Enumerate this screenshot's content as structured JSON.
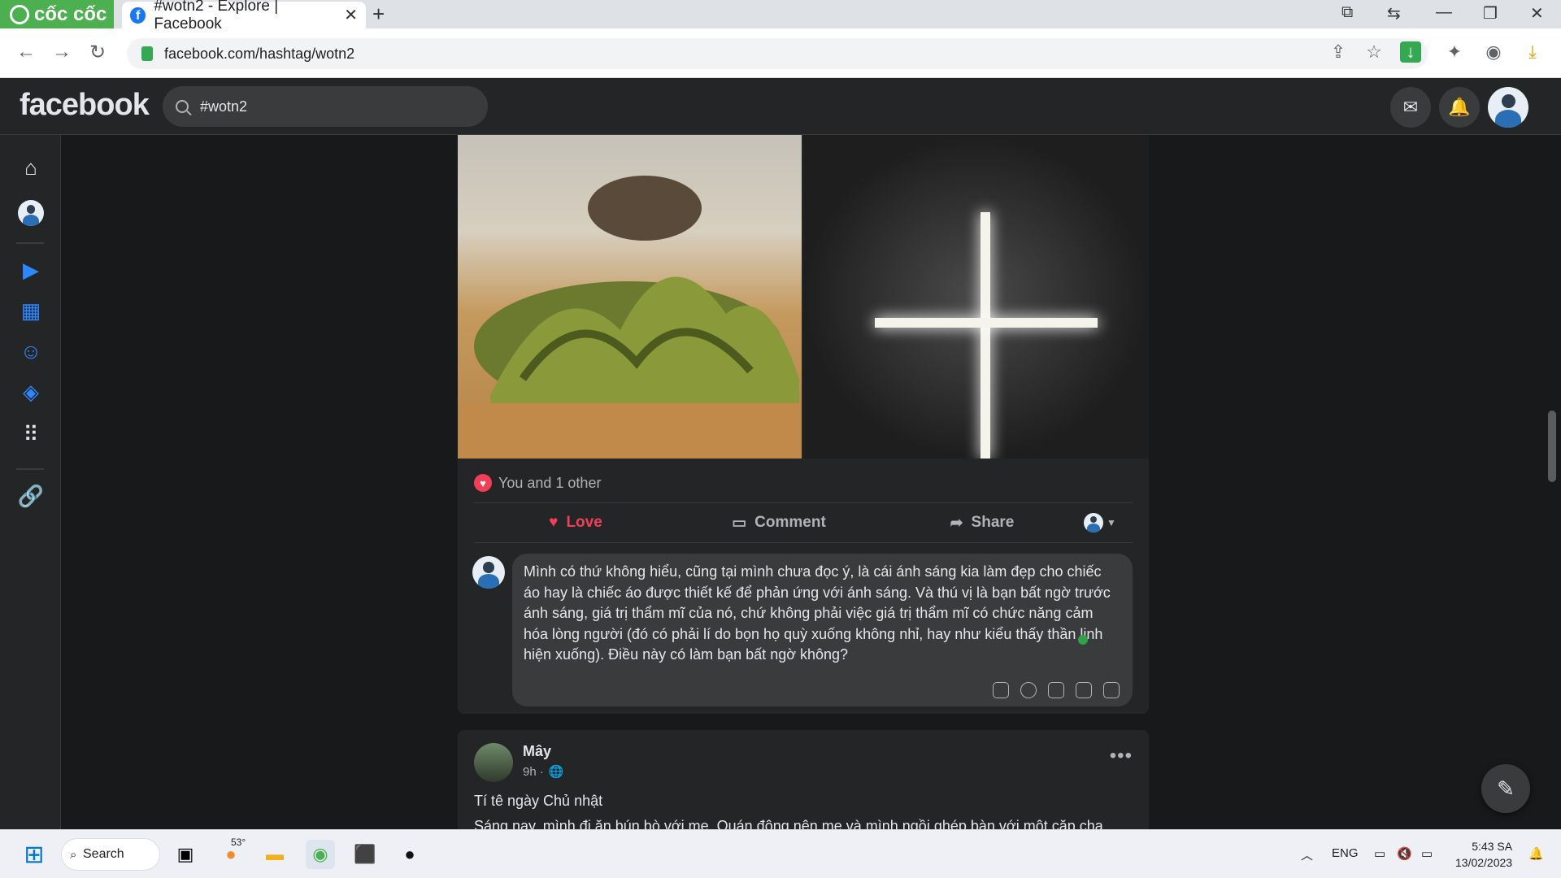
{
  "browser": {
    "brand": "cốc cốc",
    "tab_title": "#wotn2 - Explore | Facebook",
    "url": "facebook.com/hashtag/wotn2"
  },
  "fb": {
    "logo": "facebook",
    "search_value": "#wotn2"
  },
  "post1": {
    "reaction_summary": "You and 1 other",
    "actions": {
      "love": "Love",
      "comment": "Comment",
      "share": "Share"
    },
    "comment_text": "Mình có thứ không hiểu, cũng tại mình chưa đọc ý, là cái ánh sáng kia làm đẹp cho chiếc áo hay là chiếc áo được thiết kế để phản ứng với ánh sáng. Và thú vị là bạn bất ngờ trước ánh sáng, giá trị thẩm mĩ của nó, chứ không phải việc giá trị thẩm mĩ có chức năng cảm hóa lòng người (đó có phải lí do bọn họ quỳ xuống không nhỉ, hay như kiểu thấy thần linh hiện xuống). Điều này có làm bạn bất ngờ không?"
  },
  "post2": {
    "author": "Mây",
    "time": "9h ·",
    "title": "Tí tê ngày Chủ nhật",
    "body_preview": "Sáng nay, mình đi ăn bún bò với mẹ. Quán đông nên mẹ và mình ngồi ghép bàn với một cặp cha"
  },
  "taskbar": {
    "search_label": "Search",
    "weather": "53°",
    "lang": "ENG",
    "time": "5:43 SA",
    "date": "13/02/2023"
  },
  "colors": {
    "fb_bg": "#18191a",
    "surface": "#242526",
    "love": "#f33e58",
    "fb_blue": "#1877f2"
  }
}
